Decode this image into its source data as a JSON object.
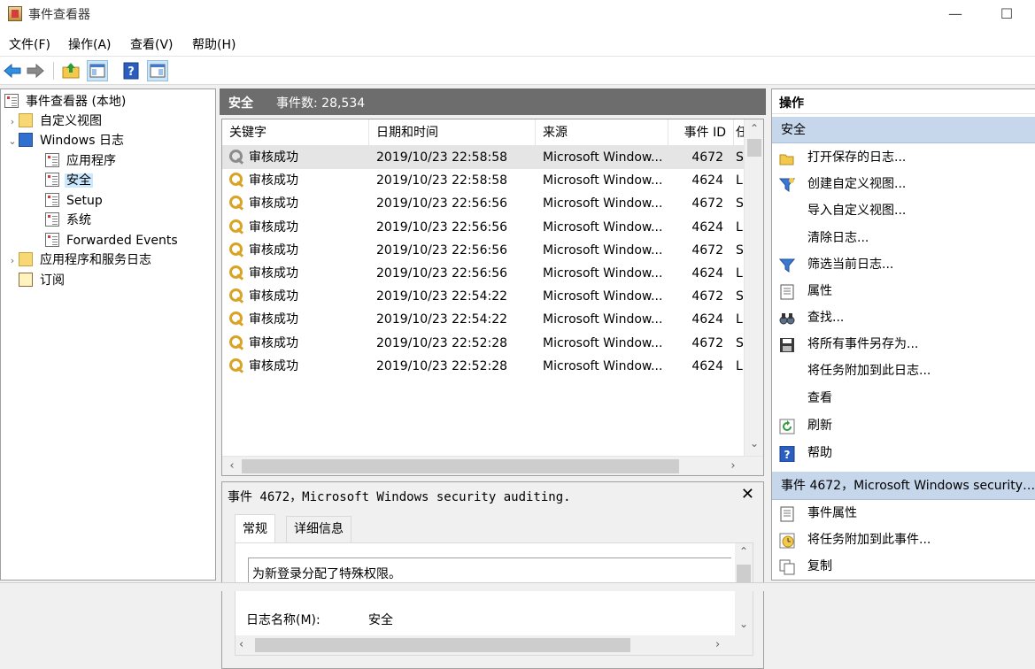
{
  "window": {
    "title": "事件查看器",
    "minimize": "—",
    "maximize": "☐"
  },
  "menu": [
    "文件(F)",
    "操作(A)",
    "查看(V)",
    "帮助(H)"
  ],
  "tree": {
    "root": "事件查看器 (本地)",
    "custom_views": "自定义视图",
    "windows_logs": "Windows 日志",
    "application": "应用程序",
    "security": "安全",
    "setup": "Setup",
    "system": "系统",
    "forwarded": "Forwarded Events",
    "app_services": "应用程序和服务日志",
    "subscriptions": "订阅"
  },
  "center": {
    "title": "安全",
    "count_label": "事件数: 28,534",
    "columns": [
      "关键字",
      "日期和时间",
      "来源",
      "事件 ID",
      "任"
    ],
    "rows": [
      {
        "kw": "审核成功",
        "dt": "2019/10/23 22:58:58",
        "src": "Microsoft Window...",
        "id": "4672",
        "task": "S"
      },
      {
        "kw": "审核成功",
        "dt": "2019/10/23 22:58:58",
        "src": "Microsoft Window...",
        "id": "4624",
        "task": "L"
      },
      {
        "kw": "审核成功",
        "dt": "2019/10/23 22:56:56",
        "src": "Microsoft Window...",
        "id": "4672",
        "task": "S"
      },
      {
        "kw": "审核成功",
        "dt": "2019/10/23 22:56:56",
        "src": "Microsoft Window...",
        "id": "4624",
        "task": "L"
      },
      {
        "kw": "审核成功",
        "dt": "2019/10/23 22:56:56",
        "src": "Microsoft Window...",
        "id": "4672",
        "task": "S"
      },
      {
        "kw": "审核成功",
        "dt": "2019/10/23 22:56:56",
        "src": "Microsoft Window...",
        "id": "4624",
        "task": "L"
      },
      {
        "kw": "审核成功",
        "dt": "2019/10/23 22:54:22",
        "src": "Microsoft Window...",
        "id": "4672",
        "task": "S"
      },
      {
        "kw": "审核成功",
        "dt": "2019/10/23 22:54:22",
        "src": "Microsoft Window...",
        "id": "4624",
        "task": "L"
      },
      {
        "kw": "审核成功",
        "dt": "2019/10/23 22:52:28",
        "src": "Microsoft Window...",
        "id": "4672",
        "task": "S"
      },
      {
        "kw": "审核成功",
        "dt": "2019/10/23 22:52:28",
        "src": "Microsoft Window...",
        "id": "4624",
        "task": "L"
      }
    ]
  },
  "detail": {
    "title_prefix": "事件",
    "title_rest": " 4672，Microsoft Windows security auditing.",
    "close": "✕",
    "tab_general": "常规",
    "tab_details": "详细信息",
    "description": "为新登录分配了特殊权限。",
    "log_name_label": "日志名称(M):",
    "log_name_value": "安全"
  },
  "actions": {
    "header": "操作",
    "section_security": "安全",
    "open_saved": "打开保存的日志...",
    "create_view": "创建自定义视图...",
    "import_view": "导入自定义视图...",
    "clear_log": "清除日志...",
    "filter_log": "筛选当前日志...",
    "properties": "属性",
    "find": "查找...",
    "save_all": "将所有事件另存为...",
    "attach_task_log": "将任务附加到此日志...",
    "view": "查看",
    "refresh": "刷新",
    "help": "帮助",
    "section_event": "事件 4672，Microsoft Windows security ...",
    "event_props": "事件属性",
    "attach_task_event": "将任务附加到此事件...",
    "copy": "复制"
  },
  "colors": {
    "accent": "#c6d7ec",
    "header_gray": "#6d6d6d",
    "selected": "#cce8ff"
  }
}
